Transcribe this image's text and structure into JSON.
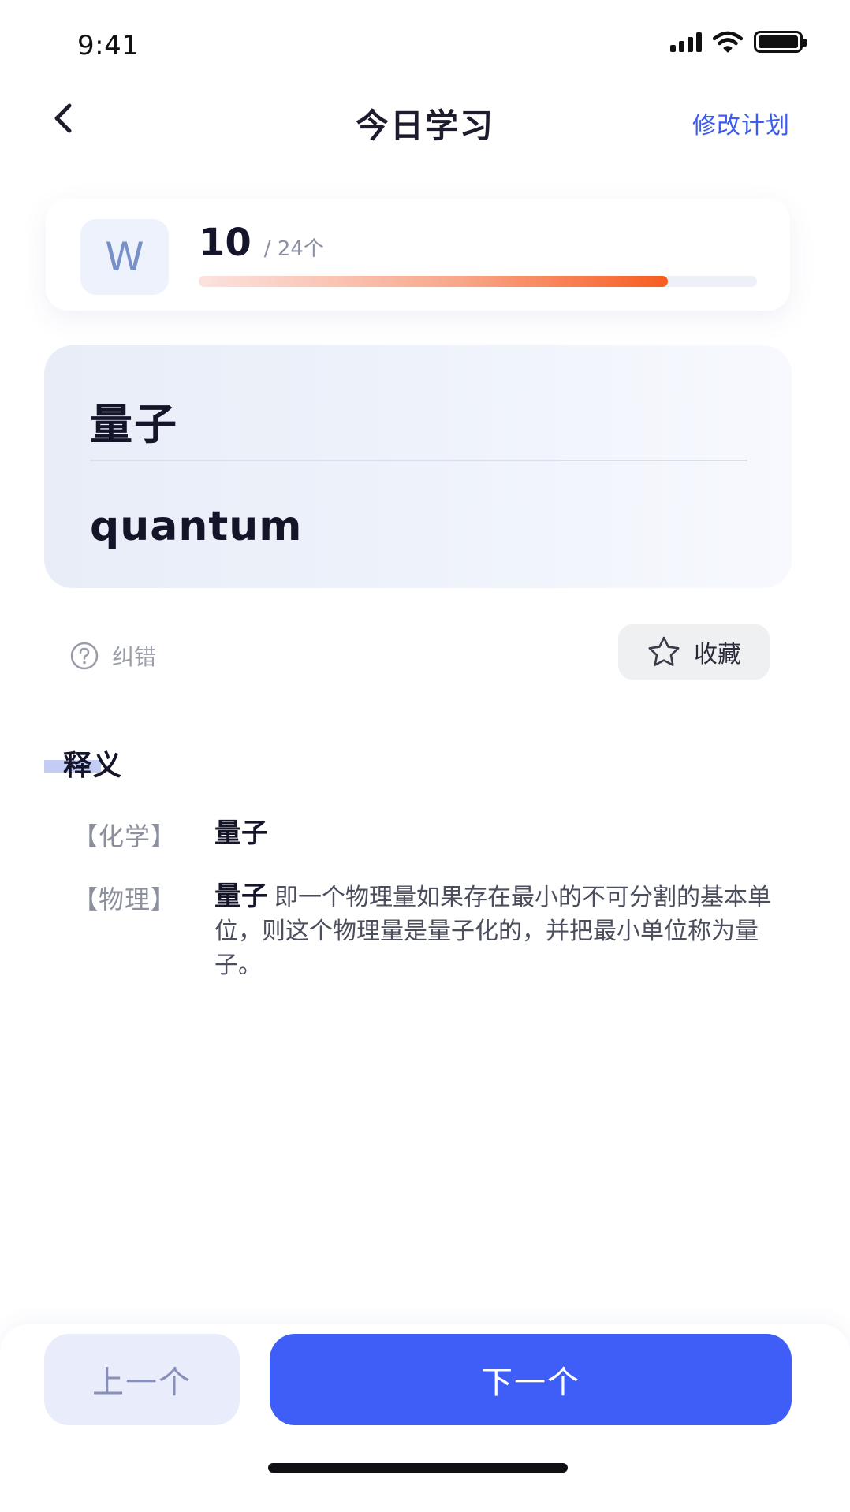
{
  "status_bar": {
    "time": "9:41",
    "icons": [
      "signal-icon",
      "wifi-icon",
      "battery-icon"
    ]
  },
  "nav": {
    "back_icon": "chevron-left-icon",
    "title": "今日学习",
    "action_label": "修改计划"
  },
  "progress": {
    "badge_letter": "W",
    "current": "10",
    "total_label": "/ 24个",
    "fraction": 0.84,
    "colors": {
      "start": "#fbe3df",
      "end": "#f75d1f",
      "track": "#eef0f8"
    }
  },
  "word": {
    "chinese": "量子",
    "english": "quantum"
  },
  "actions": {
    "report_icon": "question-circle-icon",
    "report_label": "纠错",
    "favorite_icon": "star-icon",
    "favorite_label": "收藏"
  },
  "definition": {
    "section_title": "释义",
    "entries": [
      {
        "tag": "【化学】",
        "term": "量子",
        "text": ""
      },
      {
        "tag": "【物理】",
        "term": "量子",
        "text": "即一个物理量如果存在最小的不可分割的基本单位，则这个物理量是量子化的，并把最小单位称为量子。"
      }
    ]
  },
  "footer": {
    "prev_label": "上一个",
    "next_label": "下一个"
  },
  "colors": {
    "accent": "#3f5ef7",
    "link": "#3a5cf0",
    "progress_end": "#f75d1f"
  }
}
